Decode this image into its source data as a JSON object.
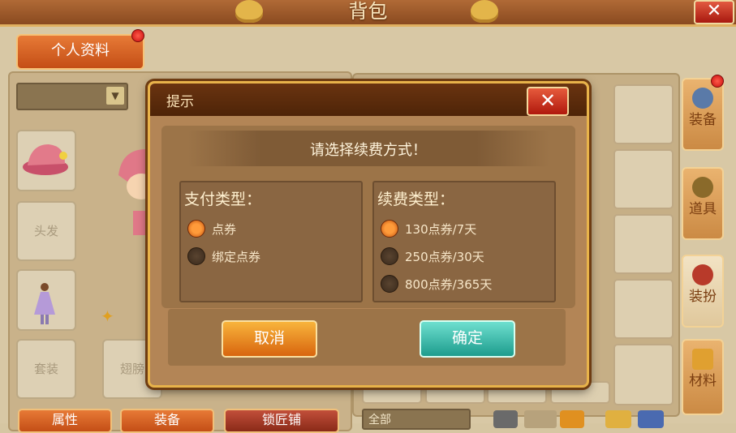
{
  "window": {
    "title": "背包",
    "close_glyph": "✕"
  },
  "profile_tab": {
    "label": "个人资料"
  },
  "equipment_slots": {
    "hair": "头发",
    "suit": "套装",
    "wings": "翅膀"
  },
  "side_tabs": [
    {
      "label": "装备",
      "icon": "shield-icon"
    },
    {
      "label": "道具",
      "icon": "pouch-icon"
    },
    {
      "label": "装扮",
      "icon": "outfit-icon"
    },
    {
      "label": "材料",
      "icon": "puzzle-icon"
    }
  ],
  "bottom": {
    "btn1": "属性",
    "btn2": "装备",
    "btn3": "锁匠铺",
    "filter": "全部"
  },
  "dialog": {
    "title": "提示",
    "close_glyph": "✕",
    "message": "请选择续费方式！",
    "payment": {
      "title": "支付类型：",
      "options": [
        {
          "label": "点券",
          "selected": true
        },
        {
          "label": "绑定点券",
          "selected": false
        }
      ]
    },
    "renewal": {
      "title": "续费类型：",
      "options": [
        {
          "label": "130点券/7天",
          "selected": true
        },
        {
          "label": "250点券/30天",
          "selected": false
        },
        {
          "label": "800点券/365天",
          "selected": false
        }
      ]
    },
    "cancel_label": "取消",
    "ok_label": "确定"
  },
  "colors": {
    "accent_orange": "#d8650e",
    "confirm_teal": "#1d9c8d",
    "dialog_brown": "#b38556"
  }
}
